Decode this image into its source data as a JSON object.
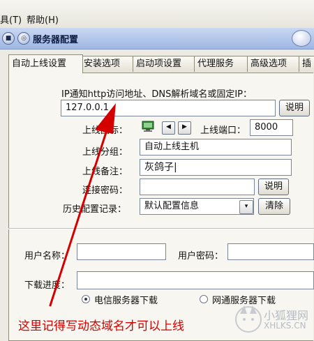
{
  "menu": {
    "tools": "具(T)",
    "help": "帮助(H)"
  },
  "window": {
    "title": "服务器配置"
  },
  "tabs": [
    "自动上线设置",
    "安装选项",
    "启动项设置",
    "代理服务",
    "高级选项",
    "插"
  ],
  "form": {
    "ip_notice": "IP通知http访问地址、DNS解析域名或固定IP：",
    "ip_value": "127.0.0.1",
    "explain_label": "说明",
    "icon_label": "上线图标：",
    "port_label": "上线端口：",
    "port_value": "8000",
    "group_label": "上线分组：",
    "group_value": "自动上线主机",
    "remark_label": "上线备注：",
    "remark_value": "灰鸽子|",
    "password_label": "连接密码：",
    "password_value": "",
    "history_label": "历史配置记录：",
    "history_value": "默认配置信息",
    "clear_label": "清除"
  },
  "download": {
    "username_label": "用户名称：",
    "username_value": "",
    "userpass_label": "用户密码：",
    "userpass_value": "",
    "progress_label": "下载进度：",
    "radio_telecom": "电信服务器下载",
    "radio_netcom": "网通服务器下载",
    "selected": "telecom"
  },
  "annotation": "这里记得写动态域名才可以上线",
  "watermark": {
    "title": "小狐狸网",
    "sub": "XHLKS.CN"
  },
  "colors": {
    "annotation": "#d40000",
    "title_bar": "#9fb7e3",
    "panel": "#f7f6f0"
  }
}
